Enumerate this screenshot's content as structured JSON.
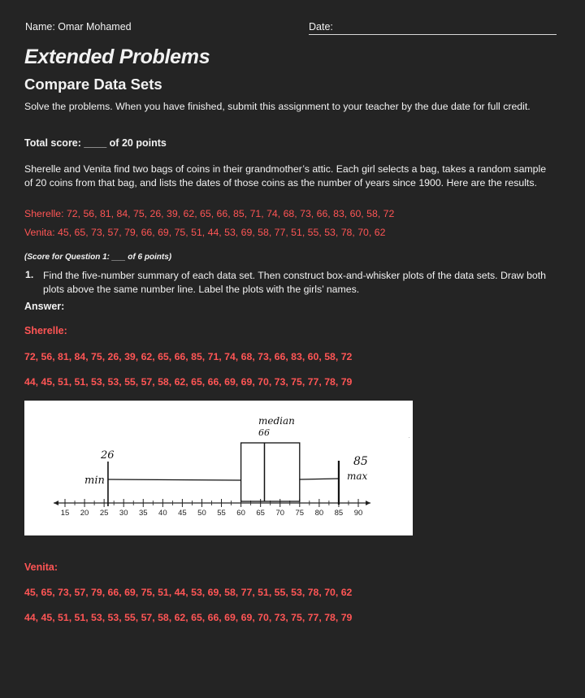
{
  "header": {
    "name": "Name: Omar Mohamed",
    "date_label": "Date:"
  },
  "title": "Extended Problems",
  "subtitle": "Compare Data Sets",
  "instructions": "Solve the problems. When you have finished, submit this assignment to your teacher by the due date for full credit.",
  "total_score": "Total score: ____ of 20 points",
  "problem_text": "Sherelle and Venita find two bags of coins in their grandmother’s attic. Each girl selects a bag, takes a random sample of 20 coins from that bag, and lists the dates of those coins as the number of years since 1900. Here are the results.",
  "sherelle_list": "Sherelle: 72, 56, 81, 84, 75, 26, 39, 62, 65, 66, 85, 71, 74, 68, 73, 66, 83, 60, 58, 72",
  "venita_list": "Venita: 45, 65, 73, 57, 79, 66, 69, 75, 51, 44, 53, 69, 58, 77, 51, 55, 53, 78, 70, 62",
  "question1": {
    "score": "(Score for Question 1: ___ of 6 points)",
    "number": "1.",
    "text": "Find the five-number summary of each data set. Then construct box-and-whisker plots of the data sets. Draw both plots above the same number line. Label the plots with the girls’ names."
  },
  "answer_label": "Answer:",
  "sherelle_answer": {
    "label": "Sherelle:",
    "data": "72, 56, 81, 84, 75, 26, 39, 62, 65, 66, 85, 71, 74, 68, 73, 66, 83, 60, 58, 72",
    "sorted": "44, 45, 51, 51, 53, 53, 55, 57, 58, 62, 65, 66, 69, 69, 70, 73, 75, 77, 78, 79"
  },
  "venita_answer": {
    "label": "Venita:",
    "data": "45, 65, 73, 57, 79, 66, 69, 75, 51, 44, 53, 69, 58, 77, 51, 55, 53, 78, 70, 62",
    "sorted": "44, 45, 51, 51, 53, 53, 55, 57, 58, 62, 65, 66, 69, 69, 70, 73, 75, 77, 78, 79"
  },
  "box_plot": {
    "axis_ticks": [
      15,
      20,
      25,
      30,
      35,
      40,
      45,
      50,
      55,
      60,
      65,
      70,
      75,
      80,
      85,
      90
    ],
    "min": 26,
    "q1": 60,
    "median": 66,
    "q3": 75,
    "max": 85,
    "annotations": {
      "median_word": "median",
      "median_value": "66",
      "min_value": "26",
      "min_word": "min",
      "max_value": "85",
      "max_word": "max"
    }
  },
  "colors": {
    "background": "#242424",
    "text": "#f2f2f2",
    "accent_red": "#ff5555"
  }
}
